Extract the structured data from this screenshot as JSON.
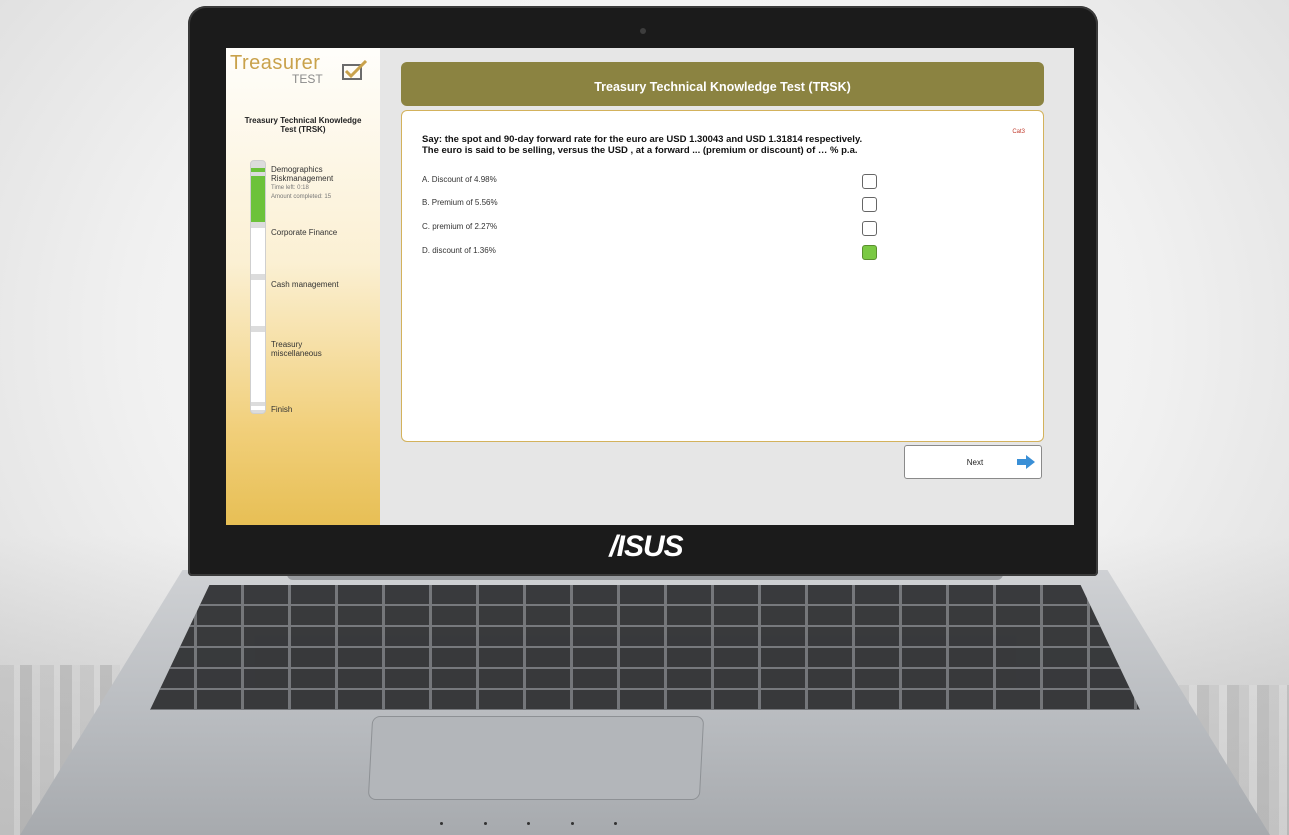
{
  "device": {
    "brand": "/ISUS"
  },
  "app": {
    "logo_word": "Treasurer",
    "logo_sub": "TEST",
    "sidebar_title": "Treasury Technical Knowledge Test (TRSK)",
    "steps": [
      {
        "label": "Demographics",
        "sub_label": "Riskmanagement",
        "time_left": "Time left: 0:18",
        "amount": "Amount completed: 15"
      },
      {
        "label": "Corporate Finance"
      },
      {
        "label": "Cash management"
      },
      {
        "label": "Treasury miscellaneous"
      },
      {
        "label": "Finish"
      }
    ]
  },
  "test": {
    "title": "Treasury Technical Knowledge Test (TRSK)",
    "category": "Cat3",
    "question_line1": "Say: the spot and 90-day forward rate for the euro are USD 1.30043 and USD 1.31814 respectively.",
    "question_line2": "The euro is said to be selling, versus the USD , at a forward ... (premium or discount) of … % p.a.",
    "options": [
      {
        "label": "A. Discount of 4.98%",
        "checked": false
      },
      {
        "label": "B. Premium of 5.56%",
        "checked": false
      },
      {
        "label": "C. premium of 2.27%",
        "checked": false
      },
      {
        "label": "D. discount of 1.36%",
        "checked": true
      }
    ],
    "next_label": "Next"
  },
  "colors": {
    "header": "#8b8341",
    "progress": "#6cc23a",
    "selected": "#7ac943",
    "panel_border": "#d3b25c"
  }
}
